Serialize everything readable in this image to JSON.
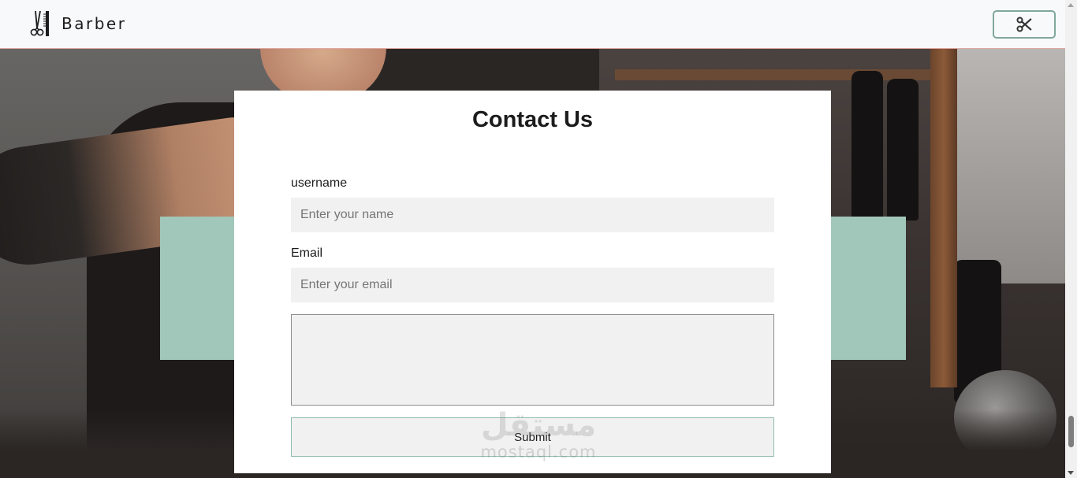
{
  "navbar": {
    "brand_name": "Barber",
    "brand_icon": "barber-tools-icon",
    "toggle_icon": "scissors-icon"
  },
  "contact": {
    "title": "Contact Us",
    "username_label": "username",
    "username_placeholder": "Enter your name",
    "email_label": "Email",
    "email_placeholder": "Enter your email",
    "message_value": "",
    "submit_label": "Submit"
  },
  "watermark": {
    "arabic_text": "مستقل",
    "url": "mostaql.com"
  },
  "colors": {
    "accent_green": "#a1c7ba",
    "navbar_bg": "#f8f9fa",
    "input_bg": "#f1f1f1",
    "toggler_border": "#7fa89b"
  }
}
